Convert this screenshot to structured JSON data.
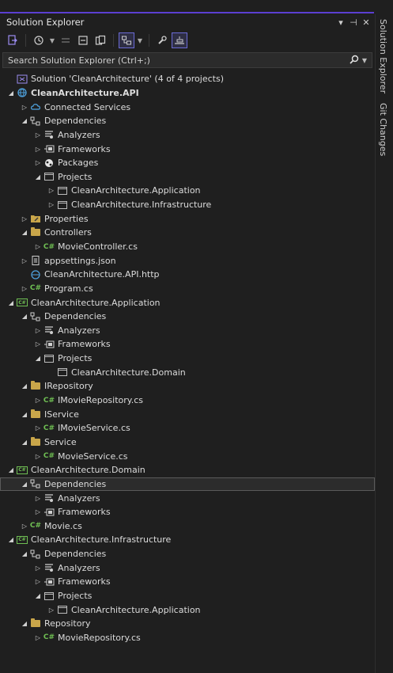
{
  "panel": {
    "title": "Solution Explorer",
    "title_buttons": [
      "▾",
      "⊣",
      "✕"
    ],
    "search_placeholder": "Search Solution Explorer (Ctrl+;)"
  },
  "toolbar": {
    "buttons": [
      {
        "icon": "sync-with-document-icon"
      },
      {
        "icon": "history-icon"
      },
      {
        "icon": "dropdown-icon"
      },
      {
        "icon": "pending-changes-filter-icon"
      },
      {
        "icon": "collapse-all-icon"
      },
      {
        "icon": "show-all-files-icon"
      },
      {
        "icon": "view-toggle-icon",
        "active": true
      },
      {
        "icon": "dropdown-icon"
      },
      {
        "icon": "properties-wrench-icon"
      },
      {
        "icon": "preview-selected-items-icon",
        "active": true
      }
    ]
  },
  "sidebar": {
    "tabs": [
      "Solution Explorer",
      "Git Changes"
    ]
  },
  "tree": [
    {
      "label": "Solution 'CleanArchitecture' (4 of 4 projects)",
      "level": 0,
      "expander": "none",
      "icon": "solution-icon"
    },
    {
      "label": "CleanArchitecture.API",
      "level": 0,
      "expander": "expanded",
      "icon": "web-project-icon",
      "bold": true
    },
    {
      "label": "Connected Services",
      "level": 1,
      "expander": "collapsed",
      "icon": "connected-services-icon"
    },
    {
      "label": "Dependencies",
      "level": 1,
      "expander": "expanded",
      "icon": "dependencies-icon"
    },
    {
      "label": "Analyzers",
      "level": 2,
      "expander": "collapsed",
      "icon": "analyzers-icon"
    },
    {
      "label": "Frameworks",
      "level": 2,
      "expander": "collapsed",
      "icon": "frameworks-icon"
    },
    {
      "label": "Packages",
      "level": 2,
      "expander": "collapsed",
      "icon": "packages-icon"
    },
    {
      "label": "Projects",
      "level": 2,
      "expander": "expanded",
      "icon": "project-reference-icon"
    },
    {
      "label": "CleanArchitecture.Application",
      "level": 3,
      "expander": "collapsed",
      "icon": "project-reference-icon"
    },
    {
      "label": "CleanArchitecture.Infrastructure",
      "level": 3,
      "expander": "collapsed",
      "icon": "project-reference-icon"
    },
    {
      "label": "Properties",
      "level": 1,
      "expander": "collapsed",
      "icon": "properties-folder-icon"
    },
    {
      "label": "Controllers",
      "level": 1,
      "expander": "expanded",
      "icon": "folder-icon"
    },
    {
      "label": "MovieController.cs",
      "level": 2,
      "expander": "collapsed",
      "icon": "csharp-file-icon"
    },
    {
      "label": "appsettings.json",
      "level": 1,
      "expander": "collapsed",
      "icon": "json-file-icon"
    },
    {
      "label": "CleanArchitecture.API.http",
      "level": 1,
      "expander": "none",
      "icon": "http-file-icon"
    },
    {
      "label": "Program.cs",
      "level": 1,
      "expander": "collapsed",
      "icon": "csharp-file-icon"
    },
    {
      "label": "CleanArchitecture.Application",
      "level": 0,
      "expander": "expanded",
      "icon": "csharp-project-icon"
    },
    {
      "label": "Dependencies",
      "level": 1,
      "expander": "expanded",
      "icon": "dependencies-icon"
    },
    {
      "label": "Analyzers",
      "level": 2,
      "expander": "collapsed",
      "icon": "analyzers-icon"
    },
    {
      "label": "Frameworks",
      "level": 2,
      "expander": "collapsed",
      "icon": "frameworks-icon"
    },
    {
      "label": "Projects",
      "level": 2,
      "expander": "expanded",
      "icon": "project-reference-icon"
    },
    {
      "label": "CleanArchitecture.Domain",
      "level": 3,
      "expander": "none",
      "icon": "project-reference-icon"
    },
    {
      "label": "IRepository",
      "level": 1,
      "expander": "expanded",
      "icon": "folder-icon"
    },
    {
      "label": "IMovieRepository.cs",
      "level": 2,
      "expander": "collapsed",
      "icon": "csharp-file-icon"
    },
    {
      "label": "IService",
      "level": 1,
      "expander": "expanded",
      "icon": "folder-icon"
    },
    {
      "label": "IMovieService.cs",
      "level": 2,
      "expander": "collapsed",
      "icon": "csharp-file-icon"
    },
    {
      "label": "Service",
      "level": 1,
      "expander": "expanded",
      "icon": "folder-icon"
    },
    {
      "label": "MovieService.cs",
      "level": 2,
      "expander": "collapsed",
      "icon": "csharp-file-icon"
    },
    {
      "label": "CleanArchitecture.Domain",
      "level": 0,
      "expander": "expanded",
      "icon": "csharp-project-icon"
    },
    {
      "label": "Dependencies",
      "level": 1,
      "expander": "expanded",
      "icon": "dependencies-icon",
      "selected": true
    },
    {
      "label": "Analyzers",
      "level": 2,
      "expander": "collapsed",
      "icon": "analyzers-icon"
    },
    {
      "label": "Frameworks",
      "level": 2,
      "expander": "collapsed",
      "icon": "frameworks-icon"
    },
    {
      "label": "Movie.cs",
      "level": 1,
      "expander": "collapsed",
      "icon": "csharp-file-icon"
    },
    {
      "label": "CleanArchitecture.Infrastructure",
      "level": 0,
      "expander": "expanded",
      "icon": "csharp-project-icon"
    },
    {
      "label": "Dependencies",
      "level": 1,
      "expander": "expanded",
      "icon": "dependencies-icon"
    },
    {
      "label": "Analyzers",
      "level": 2,
      "expander": "collapsed",
      "icon": "analyzers-icon"
    },
    {
      "label": "Frameworks",
      "level": 2,
      "expander": "collapsed",
      "icon": "frameworks-icon"
    },
    {
      "label": "Projects",
      "level": 2,
      "expander": "expanded",
      "icon": "project-reference-icon"
    },
    {
      "label": "CleanArchitecture.Application",
      "level": 3,
      "expander": "collapsed",
      "icon": "project-reference-icon"
    },
    {
      "label": "Repository",
      "level": 1,
      "expander": "expanded",
      "icon": "folder-icon"
    },
    {
      "label": "MovieRepository.cs",
      "level": 2,
      "expander": "collapsed",
      "icon": "csharp-file-icon"
    }
  ]
}
